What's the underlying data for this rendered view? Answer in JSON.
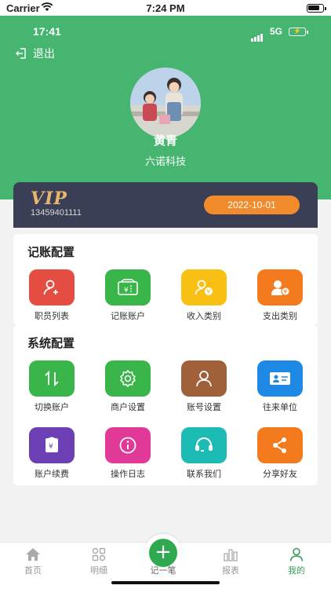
{
  "ios_status": {
    "carrier": "Carrier",
    "time": "7:24 PM"
  },
  "inner_status": {
    "time": "17:41",
    "network": "5G"
  },
  "header": {
    "logout_label": "退出",
    "user_name": "黄青",
    "company": "六诺科技"
  },
  "vip": {
    "badge": "VIP",
    "phone": "13459401111",
    "expiry": "2022-10-01"
  },
  "accounting": {
    "title": "记账配置",
    "items": [
      {
        "label": "职员列表",
        "icon": "add-user-icon",
        "color": "#e54d42"
      },
      {
        "label": "记账账户",
        "icon": "ticket-icon",
        "color": "#39b54a"
      },
      {
        "label": "收入类别",
        "icon": "user-income-icon",
        "color": "#f8c012"
      },
      {
        "label": "支出类别",
        "icon": "user-expense-icon",
        "color": "#f37b1d"
      }
    ]
  },
  "system": {
    "title": "系统配置",
    "items": [
      {
        "label": "切换账户",
        "icon": "switch-arrows-icon",
        "color": "#39b54a"
      },
      {
        "label": "商户设置",
        "icon": "gear-icon",
        "color": "#39b54a"
      },
      {
        "label": "账号设置",
        "icon": "user-icon",
        "color": "#a0603a"
      },
      {
        "label": "往来单位",
        "icon": "id-card-icon",
        "color": "#1e88e5"
      },
      {
        "label": "账户续费",
        "icon": "renew-icon",
        "color": "#6c3fb5"
      },
      {
        "label": "操作日志",
        "icon": "info-icon",
        "color": "#e03997"
      },
      {
        "label": "联系我们",
        "icon": "headset-icon",
        "color": "#1cbbb4"
      },
      {
        "label": "分享好友",
        "icon": "share-icon",
        "color": "#f37b1d"
      }
    ]
  },
  "tabbar": {
    "home": "首页",
    "details": "明细",
    "add": "记一笔",
    "report": "报表",
    "mine": "我的",
    "active_color": "#3a9b57"
  }
}
